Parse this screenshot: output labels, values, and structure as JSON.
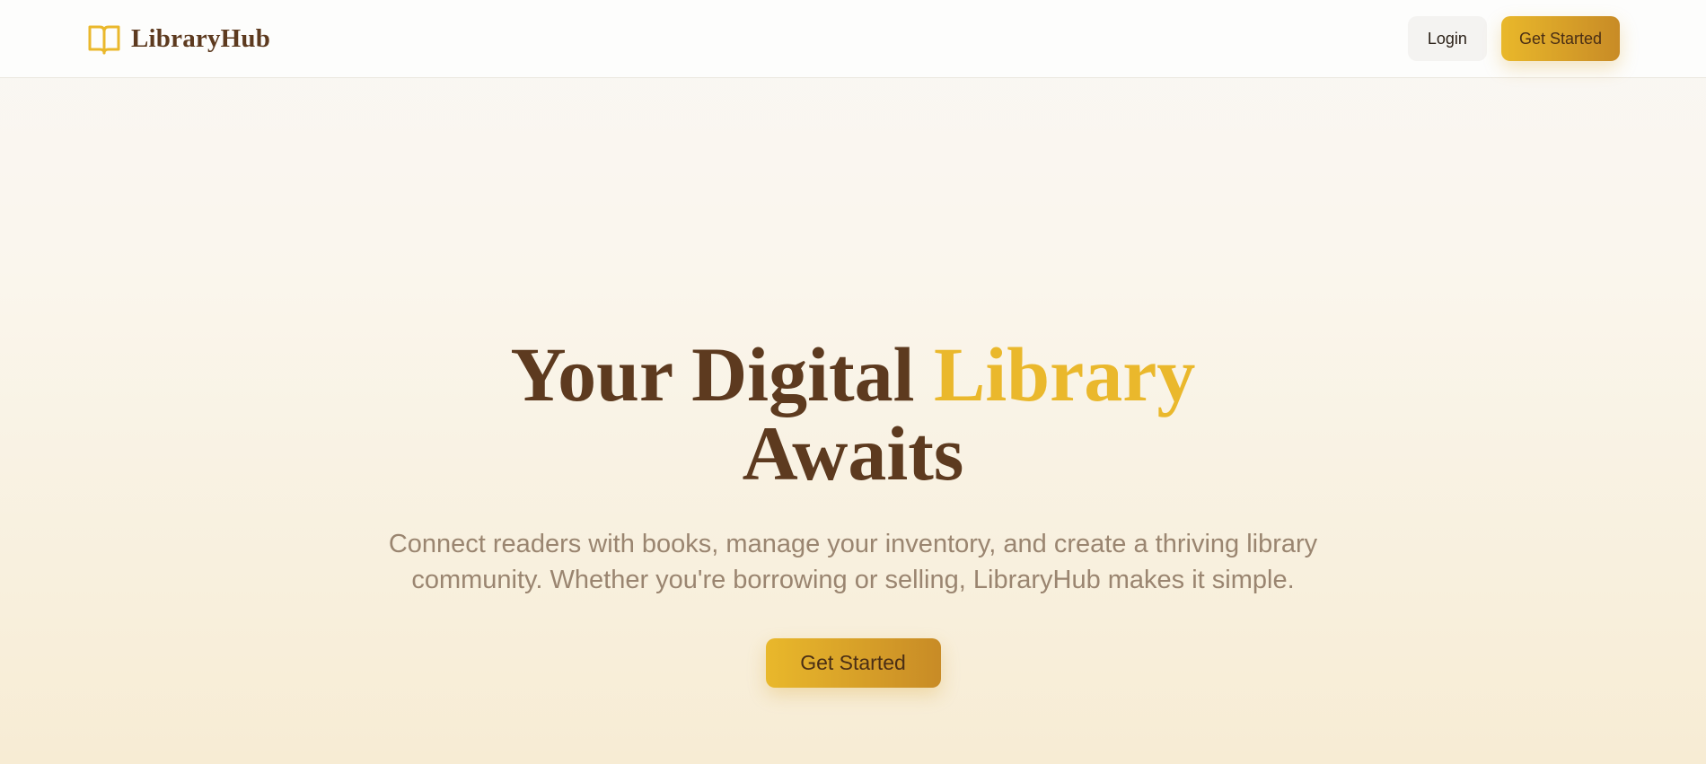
{
  "navbar": {
    "brand_name": "LibraryHub",
    "brand_icon": "open-book-icon",
    "login_label": "Login",
    "get_started_label": "Get Started"
  },
  "hero": {
    "title_part1": "Your Digital ",
    "title_accent": "Library",
    "title_part2": "Awaits",
    "subtitle": "Connect readers with books, manage your inventory, and create a thriving library community. Whether you're borrowing or selling, LibraryHub makes it simple.",
    "cta_label": "Get Started"
  },
  "colors": {
    "brand_brown": "#5d3a1f",
    "accent_gold": "#eab82c",
    "button_gradient_start": "#e9b82b",
    "button_gradient_end": "#c88b26",
    "subtitle_text": "#9a8570"
  }
}
